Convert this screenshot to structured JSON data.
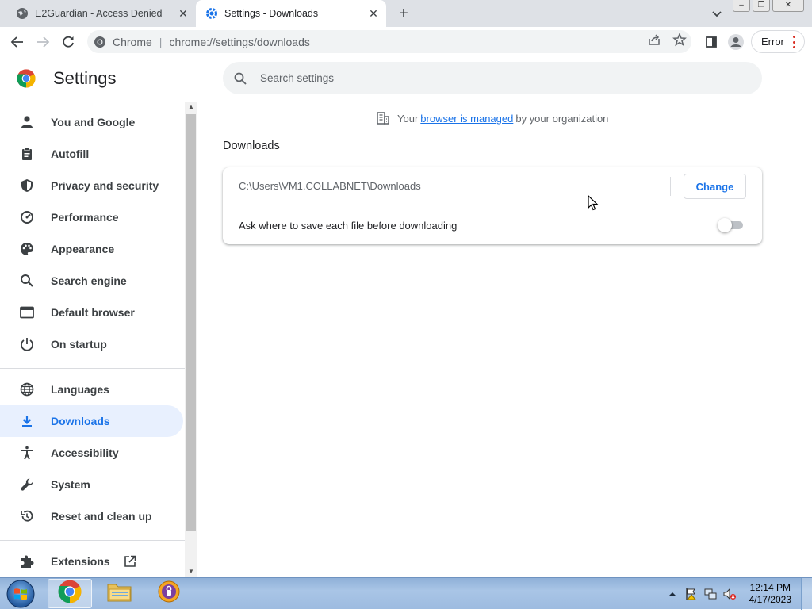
{
  "tabs": [
    {
      "title": "E2Guardian - Access Denied",
      "active": false
    },
    {
      "title": "Settings - Downloads",
      "active": true
    }
  ],
  "toolbar": {
    "scheme_label": "Chrome",
    "url": "chrome://settings/downloads",
    "error_label": "Error"
  },
  "settings": {
    "title": "Settings",
    "search_placeholder": "Search settings"
  },
  "sidebar": {
    "items": [
      {
        "label": "You and Google",
        "icon": "person-icon"
      },
      {
        "label": "Autofill",
        "icon": "clipboard-icon"
      },
      {
        "label": "Privacy and security",
        "icon": "shield-icon"
      },
      {
        "label": "Performance",
        "icon": "speedometer-icon"
      },
      {
        "label": "Appearance",
        "icon": "palette-icon"
      },
      {
        "label": "Search engine",
        "icon": "search-icon"
      },
      {
        "label": "Default browser",
        "icon": "browser-window-icon"
      },
      {
        "label": "On startup",
        "icon": "power-icon"
      },
      {
        "label": "Languages",
        "icon": "globe-icon"
      },
      {
        "label": "Downloads",
        "icon": "download-icon",
        "selected": true
      },
      {
        "label": "Accessibility",
        "icon": "accessibility-icon"
      },
      {
        "label": "System",
        "icon": "wrench-icon"
      },
      {
        "label": "Reset and clean up",
        "icon": "reset-icon"
      },
      {
        "label": "Extensions",
        "icon": "puzzle-icon"
      }
    ]
  },
  "managed": {
    "prefix": "Your",
    "link": "browser is managed",
    "suffix": "by your organization"
  },
  "downloads": {
    "section_title": "Downloads",
    "path": "C:\\Users\\VM1.COLLABNET\\Downloads",
    "change_label": "Change",
    "ask_label": "Ask where to save each file before downloading",
    "ask_enabled": false
  },
  "taskbar": {
    "time": "12:14 PM",
    "date": "4/17/2023"
  },
  "colors": {
    "accent": "#1a73e8",
    "selected_bg": "#e8f0fe",
    "error": "#d93025"
  }
}
